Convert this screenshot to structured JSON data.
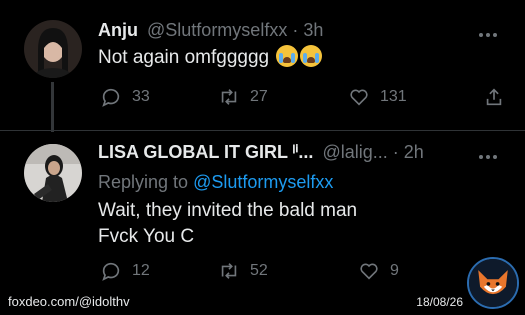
{
  "tweets": [
    {
      "name": "Anju",
      "handle": "@Slutformyselfxx",
      "dot": "·",
      "time": "3h",
      "text": "Not again omfggggg",
      "reply_count": "33",
      "retweet_count": "27",
      "like_count": "131"
    },
    {
      "name": "LISA GLOBAL IT GIRL ˡⁱ...",
      "handle": "@lalig...",
      "dot": "·",
      "time": "2h",
      "replying_prefix": "Replying to",
      "replying_handle": "@Slutformyselfxx",
      "text_line1": "Wait, they invited the bald man",
      "text_line2": "Fvck You C",
      "reply_count": "12",
      "retweet_count": "52",
      "like_count": "9"
    }
  ],
  "overlay": {
    "watermark": "foxdeo.com/@idolthv",
    "date": "18/08/26"
  },
  "colors": {
    "background": "#000000",
    "text": "#e7e9ea",
    "muted": "#71767b",
    "link": "#1d9bf0"
  }
}
